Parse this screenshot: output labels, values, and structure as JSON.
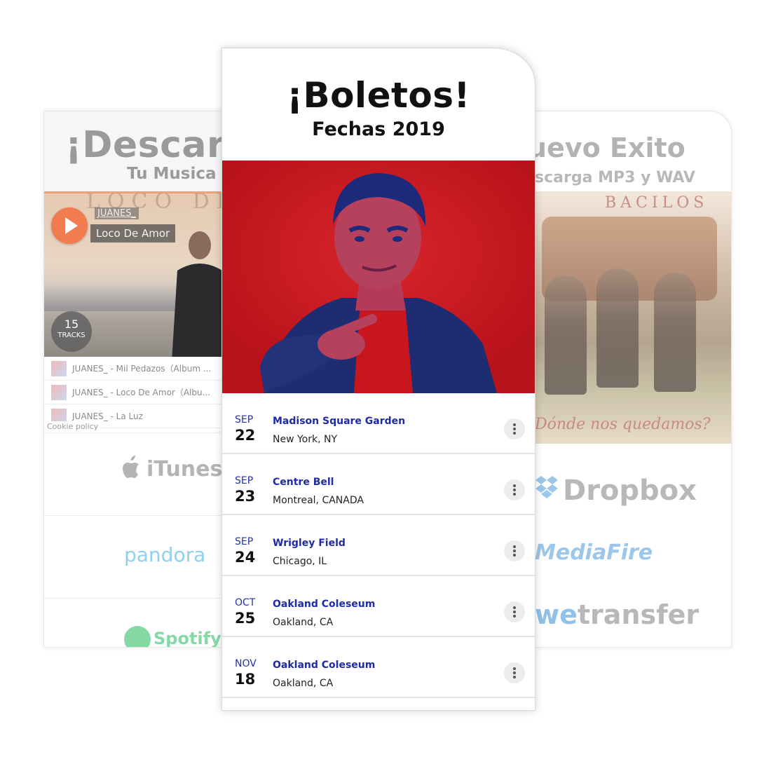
{
  "left_card": {
    "title": "¡Descarga",
    "subtitle": "Tu Musica",
    "player": {
      "cover_text": "LOCO DE A",
      "artist": "JUANES_",
      "song": "Loco De Amor",
      "track_count": "15",
      "track_label": "TRACKS"
    },
    "tracks": [
      {
        "label": "JUANES_ - Mil Pedazos（Album ..."
      },
      {
        "label": "JUANES_ - Loco De Amor（Albu..."
      },
      {
        "label": "JUANES_ - La Luz"
      }
    ],
    "cookie_label": "Cookie policy",
    "services": {
      "itunes": "iTunes",
      "pandora": "pandora",
      "spotify": "Spotify"
    }
  },
  "right_card": {
    "title": "uevo Exito",
    "subtitle": "scarga MP3 y WAV",
    "cover": {
      "band": "BACILOS",
      "tagline": "Dónde nos quedamos?"
    },
    "services": {
      "dropbox": "Dropbox",
      "mediafire": "MediaFire",
      "wetransfer_we": "we",
      "wetransfer_rest": "transfer"
    }
  },
  "center_card": {
    "title": "¡Boletos!",
    "subtitle": "Fechas 2019",
    "events": [
      {
        "month": "SEP",
        "day": "22",
        "venue": "Madison Square Garden",
        "city": "New York, NY"
      },
      {
        "month": "SEP",
        "day": "23",
        "venue": "Centre Bell",
        "city": "Montreal, CANADA"
      },
      {
        "month": "SEP",
        "day": "24",
        "venue": "Wrigley Field",
        "city": "Chicago, IL"
      },
      {
        "month": "OCT",
        "day": "25",
        "venue": "Oakland Coleseum",
        "city": "Oakland, CA"
      },
      {
        "month": "NOV",
        "day": "18",
        "venue": "Oakland Coleseum",
        "city": "Oakland, CA"
      }
    ]
  },
  "colors": {
    "photo_red": "#c8161f",
    "photo_duotone": "#1b2a7a",
    "venue_blue": "#1e2ba6",
    "play_orange": "#f07c50"
  }
}
